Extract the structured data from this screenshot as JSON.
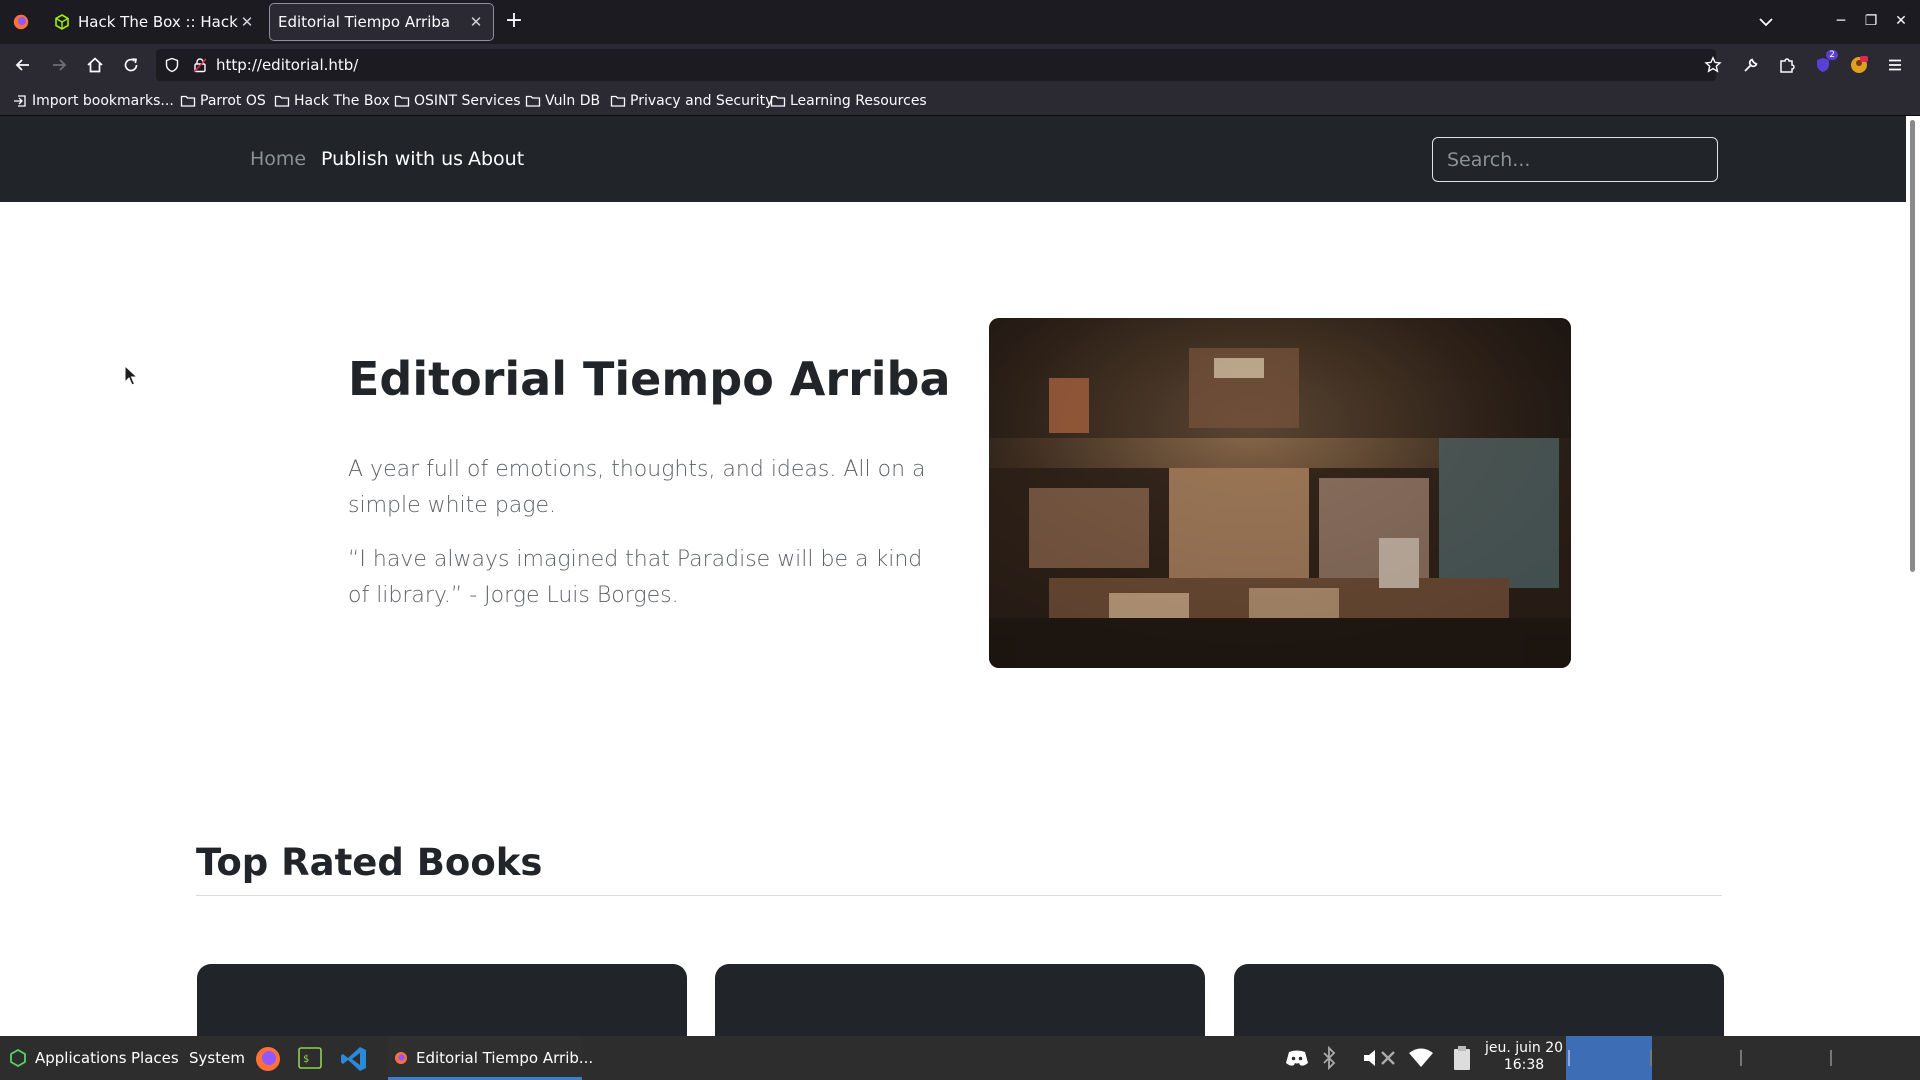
{
  "browser": {
    "tabs": [
      {
        "label": "Hack The Box :: Hack The",
        "icon": "hackthebox-icon"
      },
      {
        "label": "Editorial Tiempo Arriba",
        "icon": "none"
      }
    ],
    "url": "http://editorial.htb/",
    "bookmarks": [
      "Import bookmarks...",
      "Parrot OS",
      "Hack The Box",
      "OSINT Services",
      "Vuln DB",
      "Privacy and Security",
      "Learning Resources"
    ],
    "extension_badge": "2"
  },
  "site": {
    "nav": [
      "Home",
      "Publish with us",
      "About"
    ],
    "search_placeholder": "Search...",
    "hero": {
      "title": "Editorial Tiempo Arriba",
      "lead1": "A year full of emotions, thoughts, and ideas. All on a simple white page.",
      "lead2": "“I have always imagined that Paradise will be a kind of library.” - Jorge Luis Borges."
    },
    "section_title": "Top Rated Books"
  },
  "taskbar": {
    "applications": "Applications",
    "places": "Places",
    "system": "System",
    "active_window": "Editorial Tiempo Arrib...",
    "clock_date": "jeu. juin 20",
    "clock_time": "16:38"
  },
  "colors": {
    "site_nav_bg": "#212529",
    "browser_bg": "#1c1b22",
    "toolbar_bg": "#2b2a33",
    "taskbar_bg": "#2d2d2d"
  }
}
